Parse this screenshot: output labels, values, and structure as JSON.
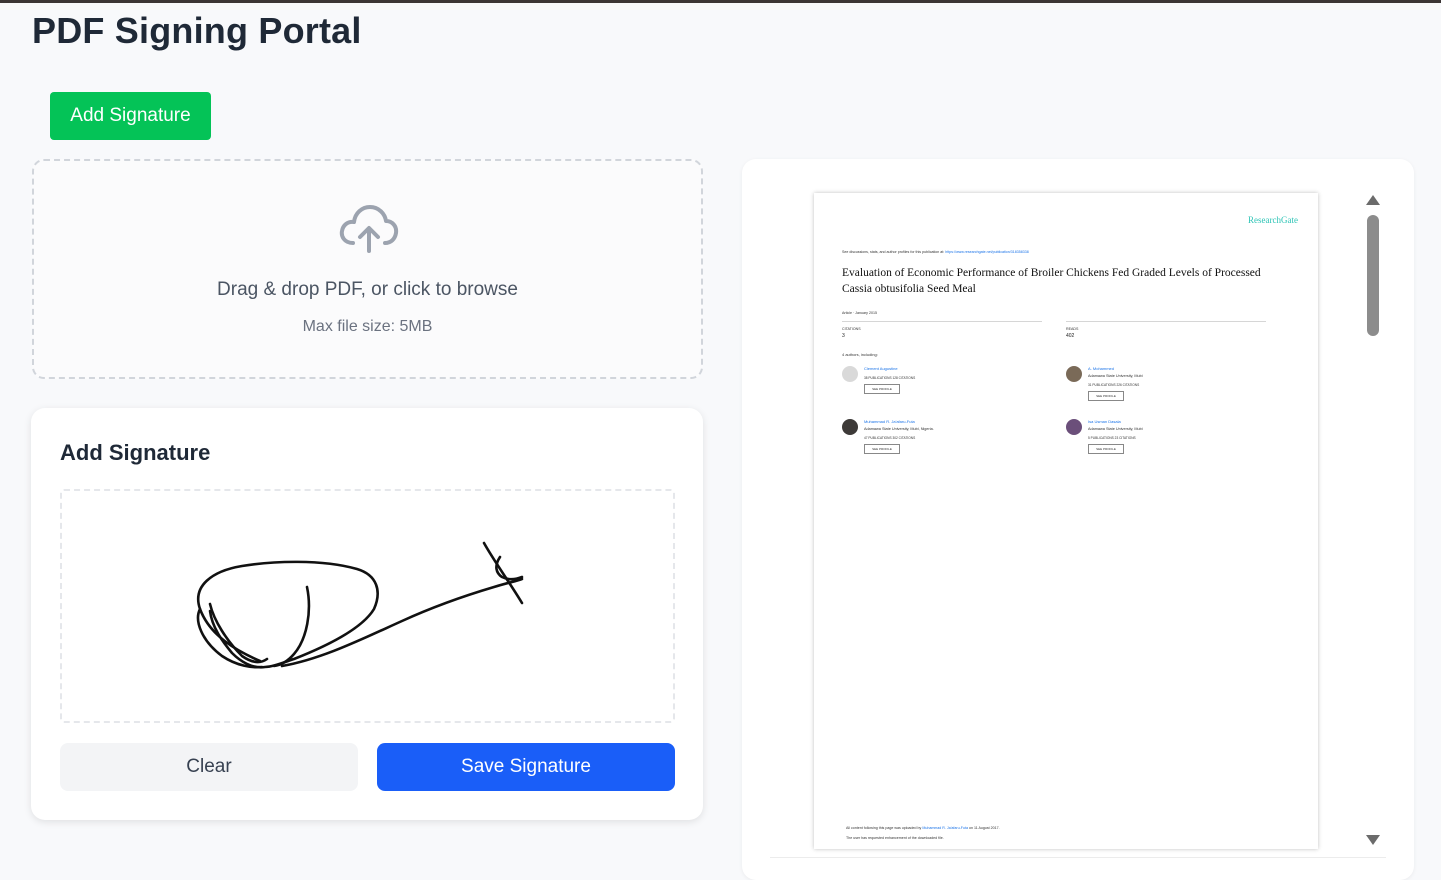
{
  "header": {
    "title": "PDF Signing Portal"
  },
  "toolbar": {
    "add_signature_label": "Add Signature"
  },
  "upload": {
    "icon": "cloud-upload-icon",
    "instruction": "Drag & drop PDF, or click to browse",
    "max_size": "Max file size: 5MB"
  },
  "signature_panel": {
    "title": "Add Signature",
    "clear_label": "Clear",
    "save_label": "Save Signature"
  },
  "pdf_preview": {
    "logo": "ResearchGate",
    "intro_text": "See discussions, stats, and author profiles for this publication at:",
    "intro_link": "https://www.researchgate.net/publication/318358338",
    "title": "Evaluation of Economic Performance of Broiler Chickens Fed Graded Levels of Processed Cassia obtusifolia Seed Meal",
    "article_meta": "Article · January 2015",
    "citations_label": "CITATIONS",
    "citations_value": "3",
    "reads_label": "READS",
    "reads_value": "402",
    "authors_intro": "4 authors, including:",
    "authors": [
      {
        "name": "Clement Augustine",
        "affiliation": "",
        "stats": "38 PUBLICATIONS   128 CITATIONS",
        "profile": "SEE PROFILE"
      },
      {
        "name": "A. Mohammed",
        "affiliation": "Adamawa State University, Mubi",
        "stats": "31 PUBLICATIONS   226 CITATIONS",
        "profile": "SEE PROFILE"
      },
      {
        "name": "Muhammad R. Ja'afaru-Futa",
        "affiliation": "Adamawa State University, Mubi, Nigeria.",
        "stats": "47 PUBLICATIONS   302 CITATIONS",
        "profile": "SEE PROFILE"
      },
      {
        "name": "Isa Usman Dasala",
        "affiliation": "Adamawa State University, Mubi",
        "stats": "5 PUBLICATIONS   23 CITATIONS",
        "profile": "SEE PROFILE"
      }
    ],
    "footer_line1": "All content following this page was uploaded by",
    "footer_link": "Muhammad R. Ja'afaru-Futa",
    "footer_line1_tail": "on 11 August 2017.",
    "footer_line2": "The user has requested enhancement of the downloaded file."
  },
  "colors": {
    "add_button": "#04c357",
    "save_button": "#1a5ef8",
    "clear_button": "#f3f4f6",
    "scroll_thumb": "#8c8c8c"
  }
}
